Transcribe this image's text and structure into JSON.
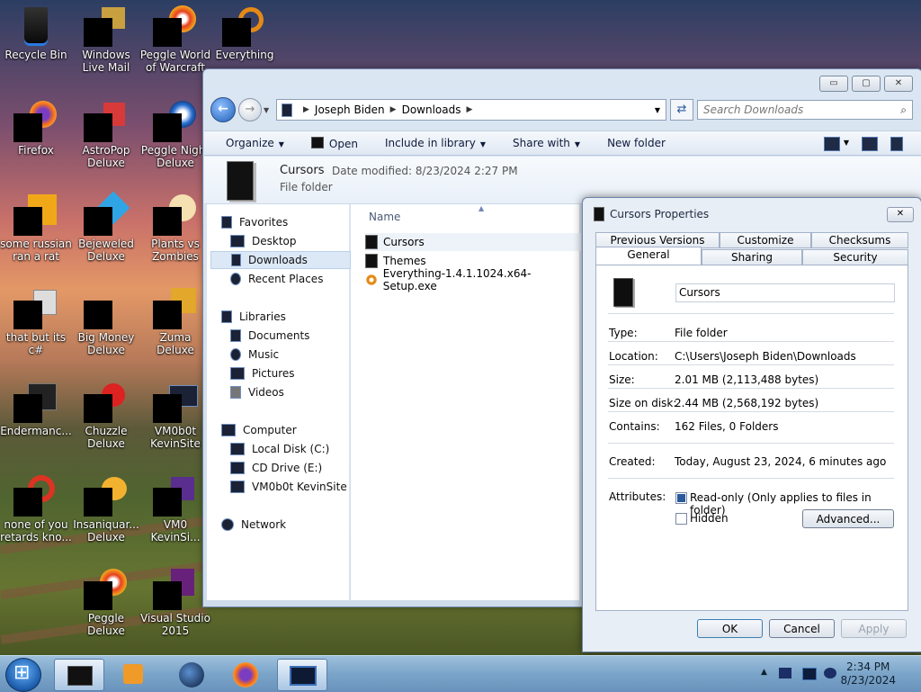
{
  "desktop": {
    "icons": [
      {
        "label": "Recycle Bin"
      },
      {
        "label": "Windows Live Mail"
      },
      {
        "label": "Peggle World of Warcraft"
      },
      {
        "label": "Everything"
      },
      {
        "label": "Firefox"
      },
      {
        "label": "AstroPop Deluxe"
      },
      {
        "label": "Peggle Night Deluxe"
      },
      {
        "label": "some russian ran a rat"
      },
      {
        "label": "Bejeweled Deluxe"
      },
      {
        "label": "Plants vs Zombies"
      },
      {
        "label": "that but its c#"
      },
      {
        "label": "Big Money Deluxe"
      },
      {
        "label": "Zuma Deluxe"
      },
      {
        "label": "Endermanc..."
      },
      {
        "label": "Chuzzle Deluxe"
      },
      {
        "label": "VM0b0t KevinSite"
      },
      {
        "label": "none of you retards kno..."
      },
      {
        "label": "Insaniquar... Deluxe"
      },
      {
        "label": "VM0 KevinSi..."
      },
      {
        "label": "Peggle Deluxe"
      },
      {
        "label": "Visual Studio 2015"
      }
    ]
  },
  "explorer": {
    "address": {
      "root_icon": "computer-icon",
      "crumbs": [
        "Joseph Biden",
        "Downloads"
      ]
    },
    "search_placeholder": "Search Downloads",
    "commands": [
      "Organize",
      "Open",
      "Include in library",
      "Share with",
      "New folder"
    ],
    "details": {
      "name": "Cursors",
      "modified": "Date modified: 8/23/2024 2:27 PM",
      "type": "File folder"
    },
    "nav": {
      "favorites": "Favorites",
      "desktop": "Desktop",
      "downloads": "Downloads",
      "recent": "Recent Places",
      "libraries": "Libraries",
      "documents": "Documents",
      "music": "Music",
      "pictures": "Pictures",
      "videos": "Videos",
      "computer": "Computer",
      "local_disk": "Local Disk (C:)",
      "cd_drive": "CD Drive (E:)",
      "vm_site": "VM0b0t KevinSite",
      "network": "Network"
    },
    "column_header": "Name",
    "files": [
      "Cursors",
      "Themes",
      "Everything-1.4.1.1024.x64-Setup.exe"
    ]
  },
  "properties": {
    "title": "Cursors Properties",
    "tabs_top": [
      "Previous Versions",
      "Customize",
      "Checksums"
    ],
    "tabs_bottom": [
      "General",
      "Sharing",
      "Security"
    ],
    "name_value": "Cursors",
    "rows": {
      "type_label": "Type:",
      "type_value": "File folder",
      "location_label": "Location:",
      "location_value": "C:\\Users\\Joseph Biden\\Downloads",
      "size_label": "Size:",
      "size_value": "2.01 MB (2,113,488 bytes)",
      "sod_label": "Size on disk:",
      "sod_value": "2.44 MB (2,568,192 bytes)",
      "contains_label": "Contains:",
      "contains_value": "162 Files, 0 Folders",
      "created_label": "Created:",
      "created_value": "Today, August 23, 2024, 6 minutes ago",
      "attributes_label": "Attributes:"
    },
    "readonly_label": "Read-only (Only applies to files in folder)",
    "hidden_label": "Hidden",
    "advanced_label": "Advanced...",
    "ok_label": "OK",
    "cancel_label": "Cancel",
    "apply_label": "Apply"
  },
  "taskbar": {
    "time": "2:34 PM",
    "date": "8/23/2024"
  }
}
